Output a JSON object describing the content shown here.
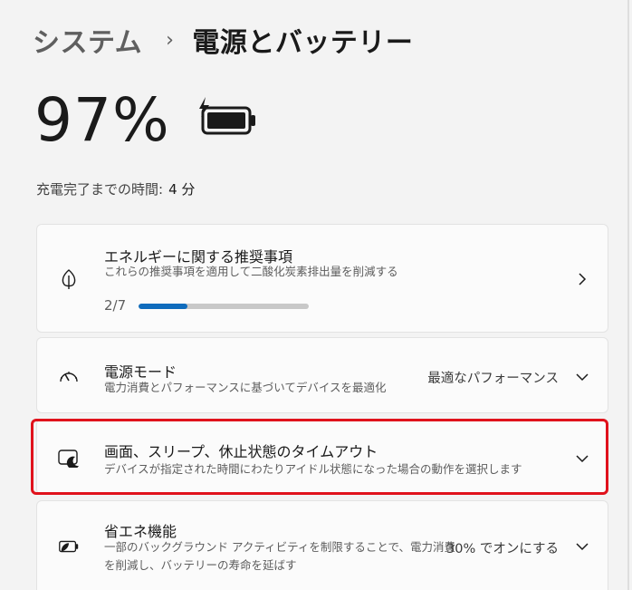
{
  "header": {
    "breadcrumb_parent": "システム",
    "breadcrumb_separator": "›",
    "breadcrumb_current": "電源とバッテリー"
  },
  "battery": {
    "percent_text": "97%",
    "charge_label": "充電完了までの時間:",
    "charge_value": "4 分",
    "icon": "battery-charging-icon"
  },
  "recommendations": {
    "title": "エネルギーに関する推奨事項",
    "description": "これらの推奨事項を適用して二酸化炭素排出量を削減する",
    "progress_text": "2/7",
    "progress_fraction": 0.2857,
    "accent_color": "#0f6cbd",
    "icon": "leaf-icon"
  },
  "power_mode": {
    "title": "電源モード",
    "description": "電力消費とパフォーマンスに基づいてデバイスを最適化",
    "value": "最適なパフォーマンス",
    "icon": "speedometer-icon"
  },
  "screen_sleep": {
    "title": "画面、スリープ、休止状態のタイムアウト",
    "description": "デバイスが指定された時間にわたりアイドル状態になった場合の動作を選択します",
    "icon": "screen-sleep-icon",
    "highlight_color": "#e0121c"
  },
  "battery_saver": {
    "title": "省エネ機能",
    "description": "一部のバックグラウンド アクティビティを制限することで、電力消費を削減し、バッテリーの寿命を延ばす",
    "value": "30% でオンにする",
    "icon": "battery-saver-icon"
  }
}
